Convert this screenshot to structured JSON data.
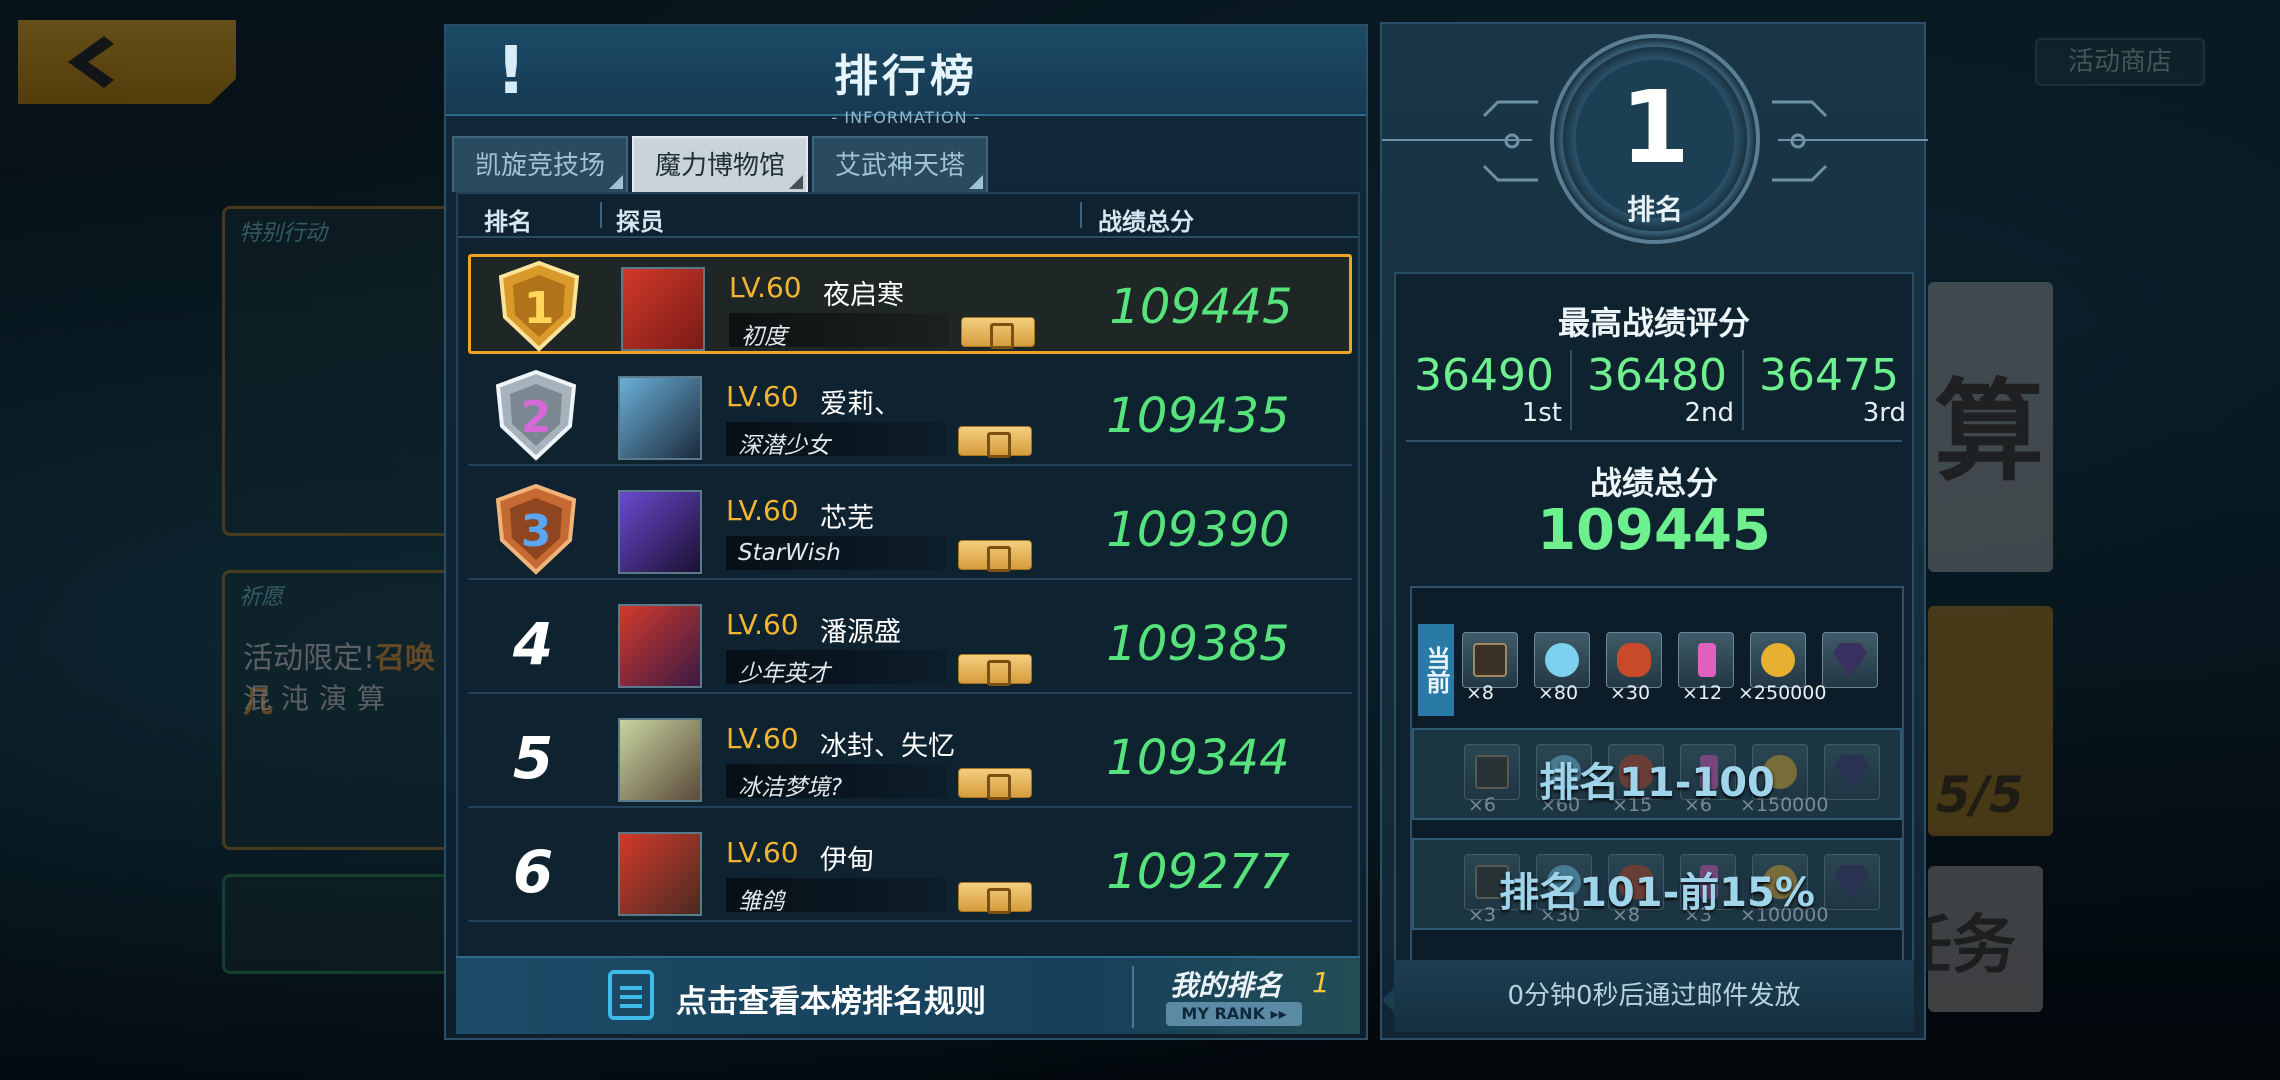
{
  "background": {
    "shop_button": "活动商店",
    "special_card_caption": "特别行动",
    "pray_card_caption": "祈愿",
    "promo_line1_prefix": "活动限定!",
    "promo_line1_highlight": "召唤几",
    "promo_line2": "混沌演算",
    "right_big_char": "算",
    "right_counter": "5/5",
    "right_task_char": "任务"
  },
  "panel": {
    "title": "排行榜",
    "subtitle": "- INFORMATION -",
    "tabs": [
      {
        "label": "凯旋竞技场",
        "active": false
      },
      {
        "label": "魔力博物馆",
        "active": true
      },
      {
        "label": "艾武神天塔",
        "active": false
      }
    ],
    "columns": {
      "rank": "排名",
      "member": "探员",
      "score": "战绩总分"
    },
    "rows": [
      {
        "rank": "1",
        "level": "LV.60",
        "name": "夜启寒",
        "title": "初度",
        "score": "109445"
      },
      {
        "rank": "2",
        "level": "LV.60",
        "name": "爱莉、",
        "title": "深潜少女",
        "score": "109435"
      },
      {
        "rank": "3",
        "level": "LV.60",
        "name": "芯芜",
        "title": "StarWish",
        "score": "109390"
      },
      {
        "rank": "4",
        "level": "LV.60",
        "name": "潘源盛",
        "title": "少年英才",
        "score": "109385"
      },
      {
        "rank": "5",
        "level": "LV.60",
        "name": "冰封、失忆",
        "title": "冰洁梦境?",
        "score": "109344"
      },
      {
        "rank": "6",
        "level": "LV.60",
        "name": "伊甸",
        "title": "雏鸽",
        "score": "109277"
      }
    ],
    "footer": {
      "rule_link": "点击查看本榜排名规则",
      "my_rank_label": "我的排名",
      "my_rank_value": "1",
      "my_rank_en": "MY RANK ▸▸"
    }
  },
  "reward_panel": {
    "rank_value": "1",
    "rank_label": "排名",
    "best_title": "最高战绩评分",
    "best_scores": [
      {
        "value": "36490",
        "ordinal": "1st"
      },
      {
        "value": "36480",
        "ordinal": "2nd"
      },
      {
        "value": "36475",
        "ordinal": "3rd"
      }
    ],
    "total_label": "战绩总分",
    "total_value": "109445",
    "current_tag": "当前",
    "tiers": [
      {
        "label": "",
        "quantities": [
          "×8",
          "×80",
          "×30",
          "×12",
          "×250000",
          ""
        ]
      },
      {
        "label": "排名11-100",
        "quantities": [
          "×6",
          "×60",
          "×15",
          "×6",
          "×150000",
          ""
        ]
      },
      {
        "label": "排名101-前15%",
        "quantities": [
          "×3",
          "×30",
          "×8",
          "×3",
          "×100000",
          ""
        ]
      }
    ],
    "mail_note": "0分钟0秒后通过邮件发放"
  },
  "colors": {
    "score_green": "#56e37c",
    "level_gold": "#f2b533",
    "highlight_border": "#f0a226",
    "accent_blue": "#3cbbea"
  },
  "icons": [
    "back-arrow-icon",
    "exclamation-icon",
    "gold-medal-icon",
    "silver-medal-icon",
    "bronze-medal-icon",
    "gift-icon",
    "clipboard-icon",
    "tarot-card-icon",
    "crystal-icon",
    "fire-stone-icon",
    "potion-icon",
    "gold-coin-icon",
    "dark-gem-icon"
  ]
}
